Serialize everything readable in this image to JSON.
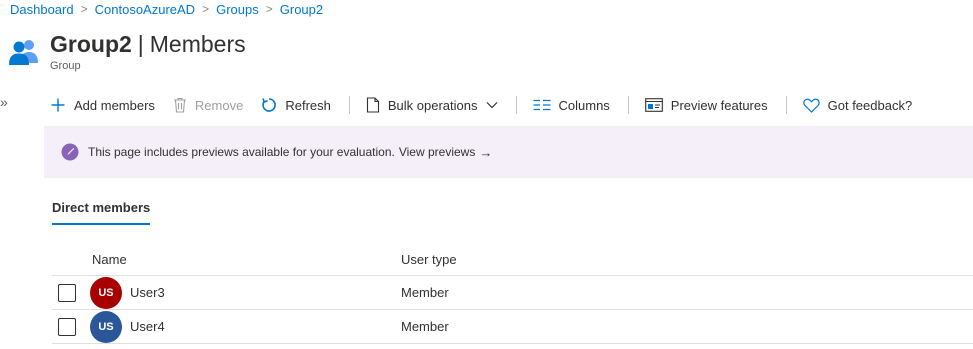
{
  "breadcrumb": {
    "items": [
      "Dashboard",
      "ContosoAzureAD",
      "Groups",
      "Group2"
    ],
    "separator": ">"
  },
  "header": {
    "title_main": "Group2",
    "title_pipe": "|",
    "title_section": "Members",
    "subtitle": "Group",
    "icon": "group-icon"
  },
  "sidebar": {
    "collapse_glyph": "»"
  },
  "toolbar": {
    "add_members": "Add members",
    "remove": "Remove",
    "refresh": "Refresh",
    "bulk_operations": "Bulk operations",
    "columns": "Columns",
    "preview_features": "Preview features",
    "got_feedback": "Got feedback?"
  },
  "banner": {
    "message": "This page includes previews available for your evaluation.",
    "link": "View previews",
    "arrow": "→"
  },
  "tabs": {
    "direct_members": "Direct members"
  },
  "table": {
    "headers": {
      "name": "Name",
      "user_type": "User type"
    },
    "rows": [
      {
        "initials": "US",
        "name": "User3",
        "user_type": "Member",
        "avatar_color": "#a80000"
      },
      {
        "initials": "US",
        "name": "User4",
        "user_type": "Member",
        "avatar_color": "#2b579a"
      }
    ]
  },
  "colors": {
    "accent": "#0078d4",
    "banner_bg": "#f4eff8",
    "preview_icon": "#8764b8"
  }
}
